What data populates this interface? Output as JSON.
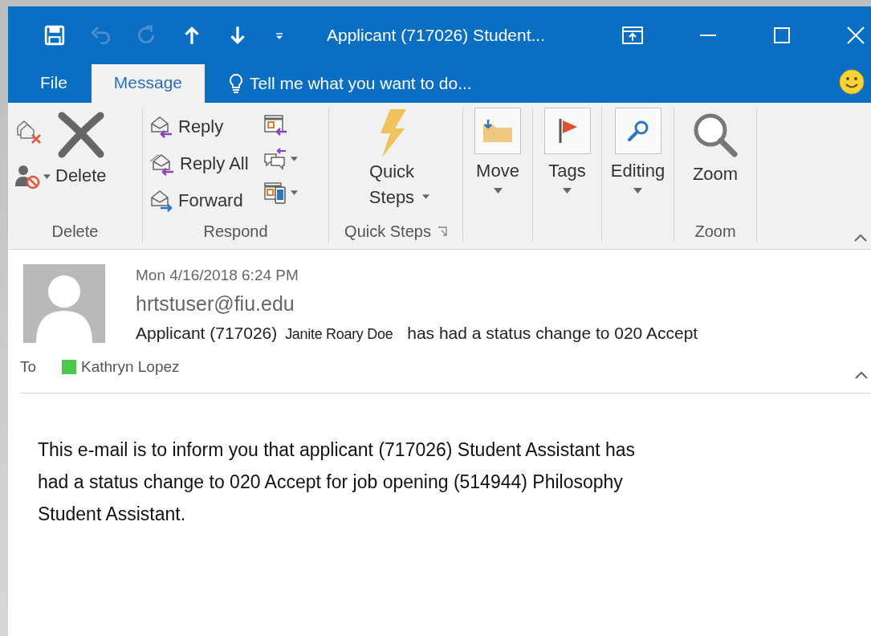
{
  "window": {
    "title": "Applicant (717026) Student..."
  },
  "quick_access": [
    {
      "kind": "save",
      "disabled": false
    },
    {
      "kind": "undo",
      "disabled": true
    },
    {
      "kind": "redo",
      "disabled": true
    },
    {
      "kind": "up",
      "disabled": false
    },
    {
      "kind": "down",
      "disabled": false
    },
    {
      "kind": "customize",
      "disabled": false
    }
  ],
  "tabs": [
    {
      "label": "File",
      "selected": false
    },
    {
      "label": "Message",
      "selected": true
    }
  ],
  "tell_me": {
    "placeholder": "Tell me what you want to do..."
  },
  "ribbon": {
    "groups": [
      {
        "kind": "delete",
        "label": "Delete",
        "button": "Delete"
      },
      {
        "kind": "respond",
        "label": "Respond",
        "actions": [
          "Reply",
          "Reply All",
          "Forward"
        ]
      },
      {
        "kind": "quick_steps",
        "label": "Quick Steps",
        "button": "Quick Steps"
      },
      {
        "kind": "move",
        "button": "Move"
      },
      {
        "kind": "tags",
        "button": "Tags"
      },
      {
        "kind": "editing",
        "button": "Editing"
      },
      {
        "kind": "zoom",
        "label": "Zoom",
        "button": "Zoom"
      }
    ]
  },
  "message": {
    "date": "Mon 4/16/2018 6:24 PM",
    "sender": "hrtstuser@fiu.edu",
    "subject": {
      "prefix": "Applicant (717026)",
      "name": "Janite Roary Doe",
      "suffix": "has had a status change to 020 Accept"
    },
    "to_label": "To",
    "recipients": [
      {
        "name": "Kathryn Lopez",
        "color": "#4cc94c"
      }
    ],
    "body": "This e-mail is to inform you that applicant (717026) Student Assistant has had a status change to 020 Accept for job opening (514944) Philosophy Student Assistant."
  }
}
